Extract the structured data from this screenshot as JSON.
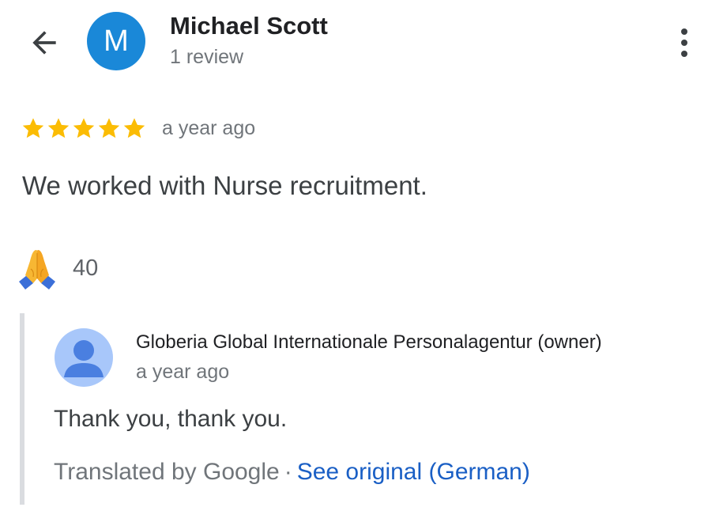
{
  "header": {
    "back_icon": "arrow-back-icon",
    "avatar_letter": "M",
    "avatar_color": "#1a88d8",
    "reviewer_name": "Michael Scott",
    "review_count": "1 review",
    "more_icon": "more-vert-icon"
  },
  "review": {
    "rating": 5,
    "rating_max": 5,
    "star_color": "#fbbc04",
    "date": "a year ago",
    "text": "We worked with Nurse recruitment."
  },
  "reaction": {
    "icon": "folded-hands-icon",
    "count": "40"
  },
  "owner_reply": {
    "avatar_icon": "person-icon",
    "name": "Globeria Global Internationale Personalagentur (owner)",
    "date": "a year ago",
    "text": "Thank you, thank you.",
    "translated_label": "Translated by Google",
    "separator": "·",
    "see_original_label": "See original (German)",
    "link_color": "#1a5fc5"
  }
}
